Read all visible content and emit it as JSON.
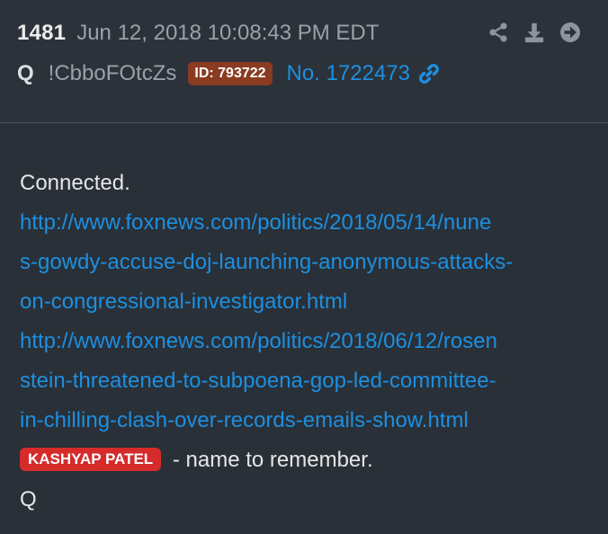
{
  "header": {
    "post_number": "1481",
    "date": "Jun 12, 2018 10:08:43 PM EDT",
    "author": "Q",
    "tripcode": "!CbboFOtcZs",
    "id_badge": "ID: 793722",
    "post_link": "No. 1722473",
    "actions": [
      {
        "icon": "share-icon"
      },
      {
        "icon": "download-icon"
      },
      {
        "icon": "arrow-right-circle-icon"
      }
    ]
  },
  "body": {
    "intro": "Connected.",
    "url1_lines": [
      "http://www.foxnews.com/politics/2018/05/14/nune",
      "s-gowdy-accuse-doj-launching-anonymous-attacks-",
      "on-congressional-investigator.html"
    ],
    "url2_lines": [
      "http://www.foxnews.com/politics/2018/06/12/rosen",
      "stein-threatened-to-subpoena-gop-led-committee-",
      "in-chilling-clash-over-records-emails-show.html"
    ],
    "name_tag": "KASHYAP PATEL",
    "name_suffix": " - name to remember.",
    "signature": "Q"
  },
  "colors": {
    "background": "#293038",
    "link": "#1d8fe0",
    "id_badge": "#8a3b21",
    "name_tag": "#d52b2b"
  }
}
